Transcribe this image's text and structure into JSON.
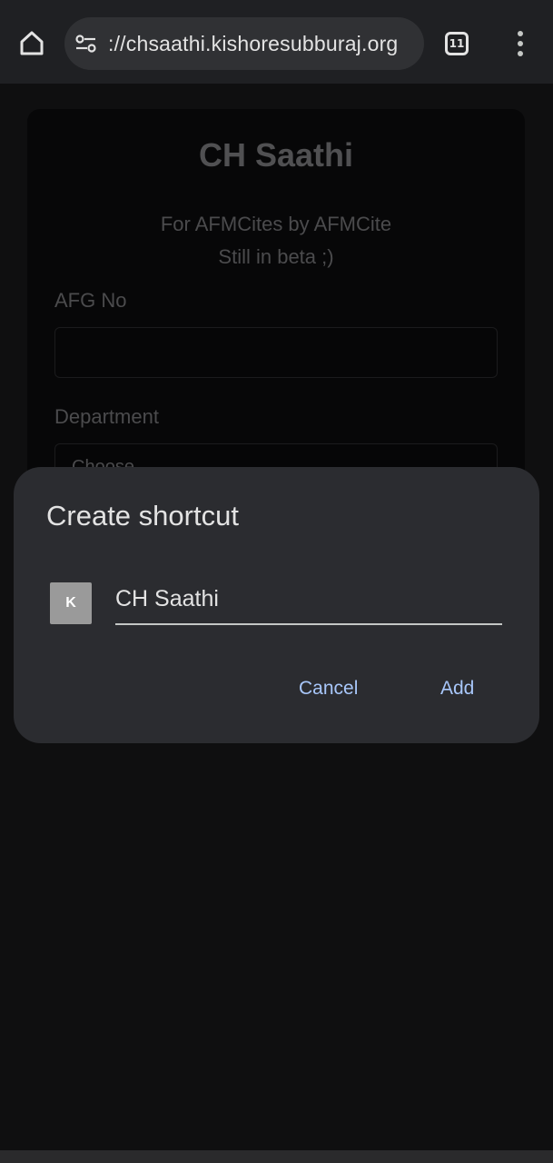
{
  "browser": {
    "url": "://chsaathi.kishoresubburaj.org",
    "tab_count": "11",
    "icons": {
      "home": "home-icon",
      "site_info": "tune-icon",
      "tabs": "tab-switcher-icon",
      "menu": "more-vert-icon"
    }
  },
  "page": {
    "title": "CH Saathi",
    "subtitle_line1": "For AFMCites by AFMCite",
    "subtitle_line2": "Still in beta ;)",
    "afg_label": "AFG No",
    "afg_value": "",
    "department_label": "Department",
    "department_selected": "Choose"
  },
  "dialog": {
    "title": "Create shortcut",
    "icon_letter": "K",
    "shortcut_name": "CH Saathi",
    "cancel_label": "Cancel",
    "add_label": "Add"
  },
  "colors": {
    "toolbar_bg": "#1f2023",
    "dialog_bg": "#2b2c30",
    "accent": "#a8c7fa"
  }
}
